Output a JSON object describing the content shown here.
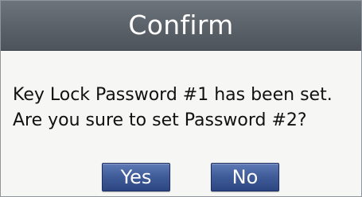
{
  "dialog": {
    "title": "Confirm",
    "message_lines": [
      "Key Lock Password #1 has been set.",
      "Are you sure to set Password #2?"
    ],
    "buttons": {
      "yes": "Yes",
      "no": "No"
    }
  },
  "colors": {
    "title_bar": "#5a6168",
    "dialog_background": "#f6f6f4",
    "button": "#3f5c99",
    "text": "#111111"
  }
}
